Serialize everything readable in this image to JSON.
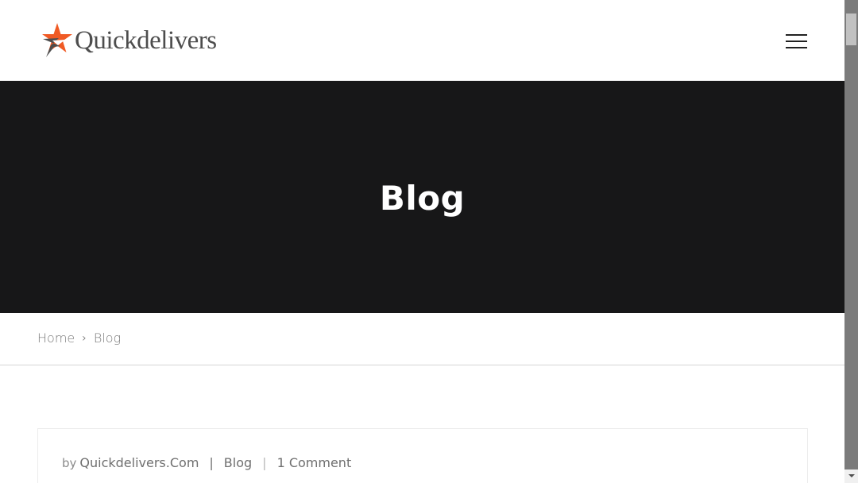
{
  "header": {
    "brand_name": "Quickdelivers",
    "menu_icon": "hamburger-menu-icon",
    "logo_icon": "star-logo-icon",
    "colors": {
      "logo_star_orange": "#f05a24",
      "logo_star_gray": "#4d4d4d",
      "text": "#4d4d4d"
    }
  },
  "hero": {
    "title": "Blog",
    "background": "#171718"
  },
  "breadcrumb": {
    "items": [
      {
        "label": "Home"
      },
      {
        "label": "Blog"
      }
    ],
    "separator": "›"
  },
  "post": {
    "meta": {
      "by": "by",
      "author": "Quickdelivers.Com",
      "divider": "|",
      "category": "Blog",
      "comments": "1 Comment"
    }
  }
}
